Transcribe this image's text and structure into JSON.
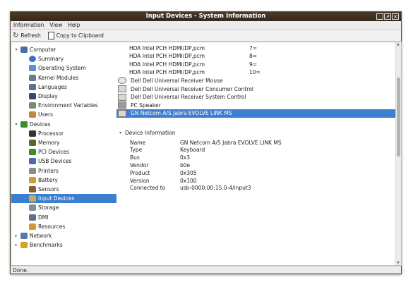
{
  "window": {
    "title": "Input Devices - System Information"
  },
  "menu": [
    "Information",
    "View",
    "Help"
  ],
  "toolbar": {
    "refresh": "Refresh",
    "copy": "Copy to Clipboard"
  },
  "tree": [
    {
      "label": "Computer",
      "level": 0,
      "expander": "▾",
      "icon": "computer-icon",
      "color": "#4a6fa5"
    },
    {
      "label": "Summary",
      "level": 1,
      "icon": "info-icon",
      "color": "#3b74c7"
    },
    {
      "label": "Operating System",
      "level": 1,
      "icon": "os-icon",
      "color": "#5a8fd0"
    },
    {
      "label": "Kernel Modules",
      "level": 1,
      "icon": "module-icon",
      "color": "#6d7a88"
    },
    {
      "label": "Languages",
      "level": 1,
      "icon": "languages-icon",
      "color": "#5f6f8f"
    },
    {
      "label": "Display",
      "level": 1,
      "icon": "display-icon",
      "color": "#3a4a66"
    },
    {
      "label": "Environment Variables",
      "level": 1,
      "icon": "env-icon",
      "color": "#7b8b6a"
    },
    {
      "label": "Users",
      "level": 1,
      "icon": "users-icon",
      "color": "#c08a3c"
    },
    {
      "label": "Devices",
      "level": 0,
      "expander": "▾",
      "icon": "devices-icon",
      "color": "#3d8b2c"
    },
    {
      "label": "Processor",
      "level": 1,
      "icon": "processor-icon",
      "color": "#333333"
    },
    {
      "label": "Memory",
      "level": 1,
      "icon": "memory-icon",
      "color": "#4f6b2f"
    },
    {
      "label": "PCI Devices",
      "level": 1,
      "icon": "pci-icon",
      "color": "#3d8b2c"
    },
    {
      "label": "USB Devices",
      "level": 1,
      "icon": "usb-icon",
      "color": "#4d6aa8"
    },
    {
      "label": "Printers",
      "level": 1,
      "icon": "printer-icon",
      "color": "#8a8a8a"
    },
    {
      "label": "Battery",
      "level": 1,
      "icon": "battery-icon",
      "color": "#c9a037"
    },
    {
      "label": "Sensors",
      "level": 1,
      "icon": "sensor-icon",
      "color": "#8a5a3a"
    },
    {
      "label": "Input Devices",
      "level": 1,
      "icon": "input-icon",
      "color": "#c7a865",
      "selected": true
    },
    {
      "label": "Storage",
      "level": 1,
      "icon": "storage-icon",
      "color": "#8c8c8c"
    },
    {
      "label": "DMI",
      "level": 1,
      "icon": "dmi-icon",
      "color": "#5e6f8c"
    },
    {
      "label": "Resources",
      "level": 1,
      "icon": "resources-icon",
      "color": "#d09a2f"
    },
    {
      "label": "Network",
      "level": 0,
      "expander": "▸",
      "icon": "network-icon",
      "color": "#5777b0"
    },
    {
      "label": "Benchmarks",
      "level": 0,
      "expander": "▸",
      "icon": "benchmarks-icon",
      "color": "#d7a21f"
    }
  ],
  "device_list": [
    {
      "name": "HDA Intel PCH HDMI/DP,pcm",
      "value": "7=",
      "icon": ""
    },
    {
      "name": "HDA Intel PCH HDMI/DP,pcm",
      "value": "8=",
      "icon": ""
    },
    {
      "name": "HDA Intel PCH HDMI/DP,pcm",
      "value": "9=",
      "icon": ""
    },
    {
      "name": "HDA Intel PCH HDMI/DP,pcm",
      "value": "10=",
      "icon": ""
    },
    {
      "name": "Dell Dell Universal Receiver Mouse",
      "value": "",
      "icon": "mouse-icon"
    },
    {
      "name": "Dell Dell Universal Receiver Consumer Control",
      "value": "",
      "icon": "keyboard-icon"
    },
    {
      "name": "Dell Dell Universal Receiver System Control",
      "value": "",
      "icon": "keyboard-icon"
    },
    {
      "name": "PC Speaker",
      "value": "",
      "icon": "speaker-icon"
    },
    {
      "name": "GN Netcom A/S Jabra EVOLVE LINK MS",
      "value": "",
      "icon": "keyboard-icon",
      "selected": true
    }
  ],
  "detail": {
    "section": "Device Information",
    "rows": [
      {
        "label": "Name",
        "value": "GN Netcom A/S Jabra EVOLVE LINK MS"
      },
      {
        "label": "Type",
        "value": "Keyboard"
      },
      {
        "label": "Bus",
        "value": "0x3"
      },
      {
        "label": "Vendor",
        "value": "b0e"
      },
      {
        "label": "Product",
        "value": "0x305"
      },
      {
        "label": "Version",
        "value": "0x100"
      },
      {
        "label": "Connected to",
        "value": "usb-0000:00:15.0-4/input3"
      }
    ]
  },
  "status": "Done."
}
